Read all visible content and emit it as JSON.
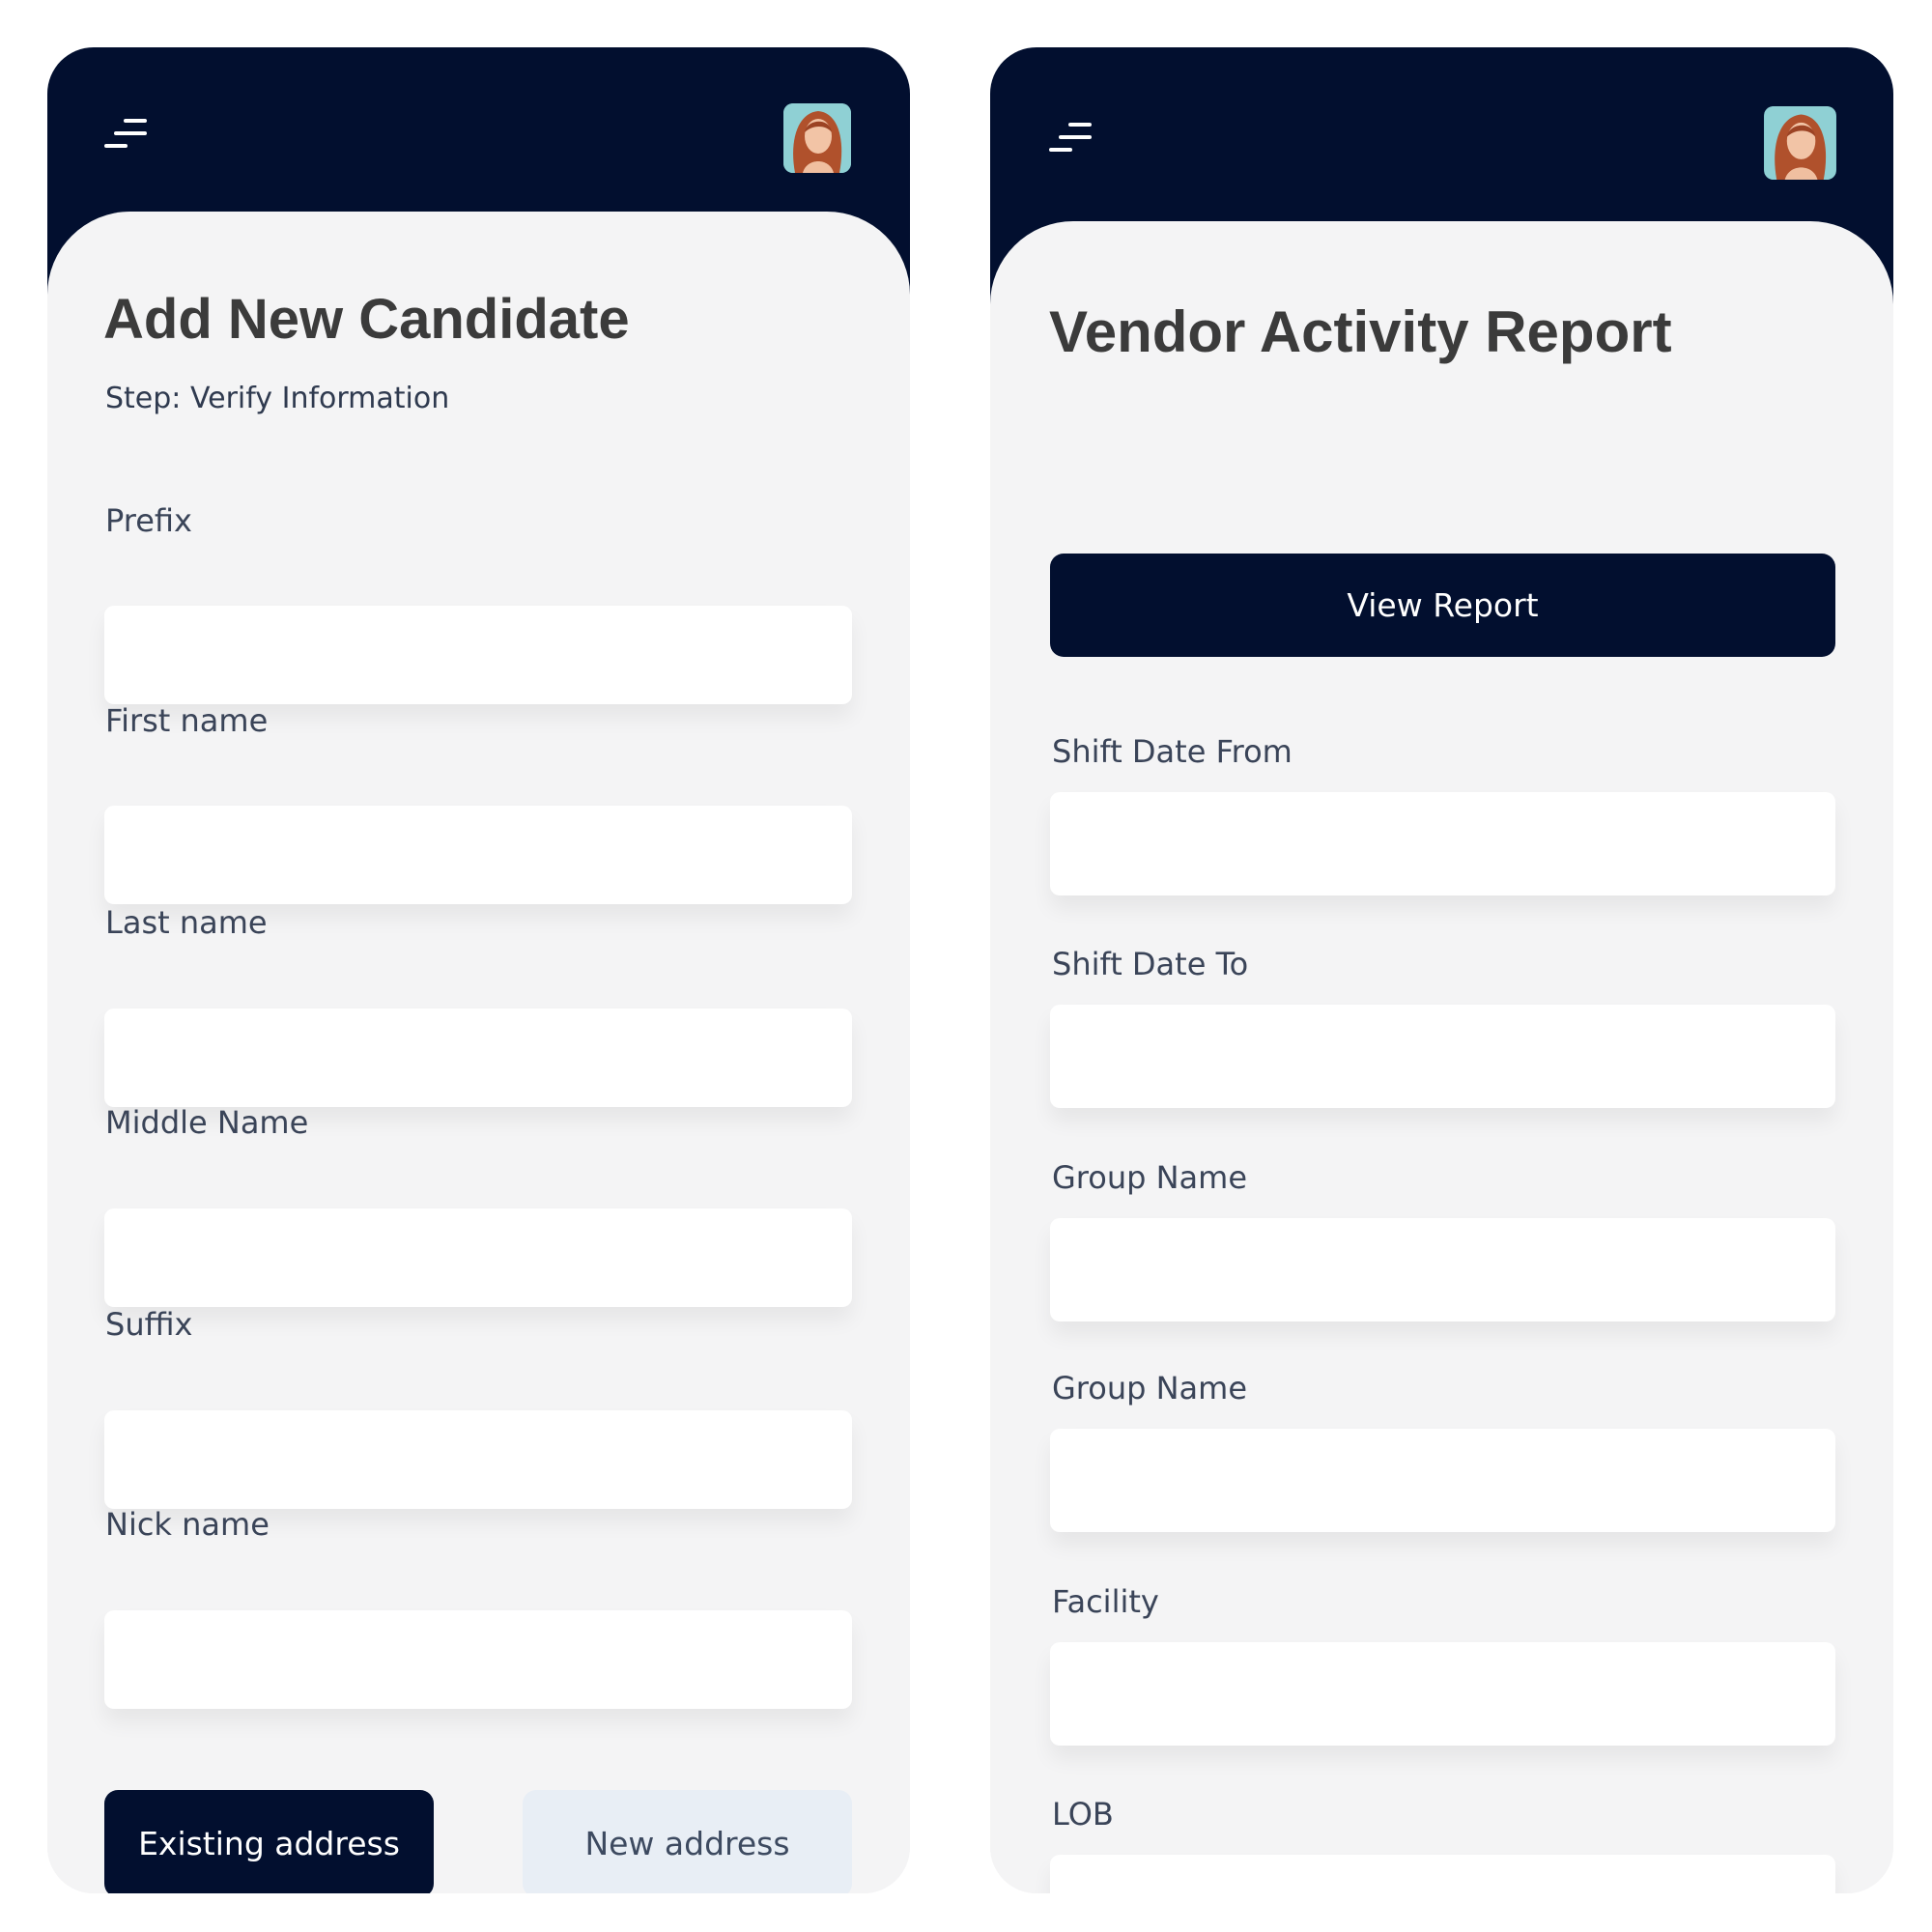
{
  "screens": {
    "candidate": {
      "title": "Add New Candidate",
      "subtitle": "Step: Verify Information",
      "fields": [
        {
          "label": "Prefix",
          "value": ""
        },
        {
          "label": "First name",
          "value": ""
        },
        {
          "label": "Last name",
          "value": ""
        },
        {
          "label": "Middle Name",
          "value": ""
        },
        {
          "label": "Suffix",
          "value": ""
        },
        {
          "label": "Nick name",
          "value": ""
        }
      ],
      "buttons": {
        "existing_address": "Existing address",
        "new_address": "New address"
      }
    },
    "report": {
      "title": "Vendor Activity Report",
      "view_report": "View Report",
      "fields": [
        {
          "label": "Shift Date From",
          "value": ""
        },
        {
          "label": "Shift Date To",
          "value": ""
        },
        {
          "label": "Group Name",
          "value": ""
        },
        {
          "label": "Group Name",
          "value": ""
        },
        {
          "label": "Facility",
          "value": ""
        },
        {
          "label": "LOB",
          "value": ""
        }
      ]
    }
  },
  "icons": {
    "menu": "menu-icon",
    "avatar": "avatar"
  },
  "colors": {
    "navy": "#020f2f",
    "background": "#f4f4f5",
    "light_button": "#e8eef5",
    "text_dark": "#3b3b3b"
  }
}
